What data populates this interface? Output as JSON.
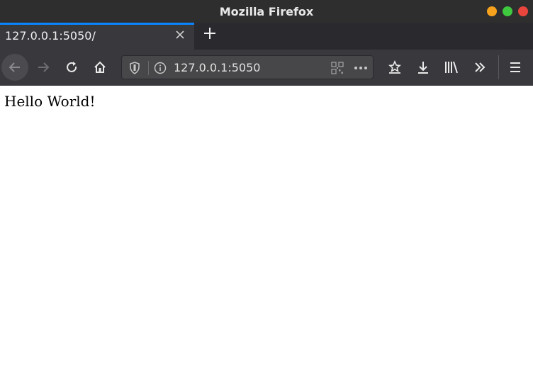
{
  "window": {
    "title": "Mozilla Firefox",
    "controls": [
      "minimize",
      "maximize",
      "close"
    ]
  },
  "tabs": [
    {
      "label": "127.0.0.1:5050/",
      "active": true
    }
  ],
  "toolbar": {
    "url": "127.0.0.1:5050",
    "icons": [
      "back-icon",
      "forward-icon",
      "reload-icon",
      "home-icon",
      "shield-icon",
      "info-icon",
      "qr-code-icon",
      "more-icon",
      "bookmark-icon",
      "download-icon",
      "library-icon",
      "overflow-icon",
      "menu-icon"
    ]
  },
  "page": {
    "body_text": "Hello World!"
  },
  "colors": {
    "accent": "#0a84ff",
    "toolbar_bg": "#38383d",
    "titlebar_bg": "#2e2e2e"
  }
}
